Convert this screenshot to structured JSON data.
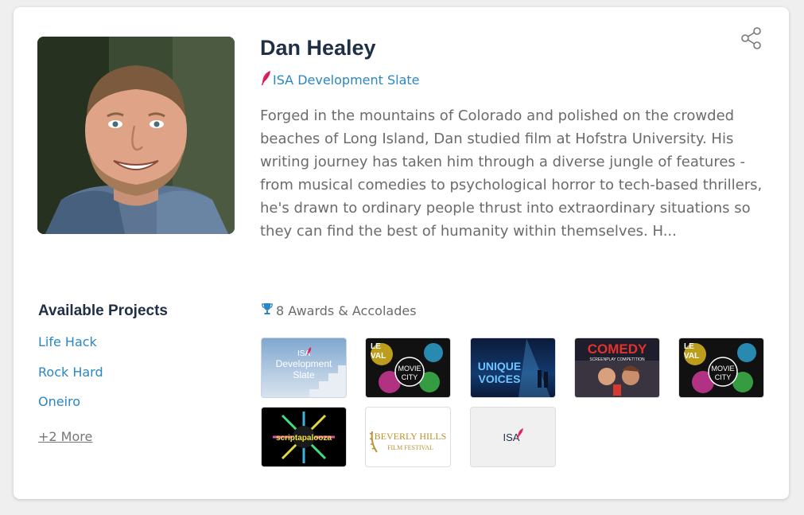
{
  "profile": {
    "name": "Dan Healey",
    "slate_label": "ISA Development Slate",
    "bio": "Forged in the mountains of Colorado and polished on the crowded beaches of Long Island, Dan studied film at Hofstra University. His writing journey has taken him through a diverse jungle of features - from musical comedies to psychological horror to tech-based thrillers, he's drawn to ordinary people thrust into extraordinary situations so they can find the best of humanity within themselves. H..."
  },
  "projects": {
    "title": "Available Projects",
    "items": [
      "Life Hack",
      "Rock Hard",
      "Oneiro"
    ],
    "more": "+2 More"
  },
  "awards": {
    "label": "8 Awards & Accolades",
    "badges": [
      {
        "lines": [
          "ISA",
          "Development",
          "Slate"
        ]
      },
      {
        "lines": [
          "LE",
          "VAL",
          "MOVIE",
          "CITY"
        ]
      },
      {
        "lines": [
          "UNIQUE",
          "VOICES"
        ]
      },
      {
        "lines": [
          "COMEDY",
          "SCREENPLAY COMPETITION"
        ]
      },
      {
        "lines": [
          "LE",
          "VAL",
          "MOVIE",
          "CITY"
        ]
      },
      {
        "lines": [
          "scriptapalooza"
        ]
      },
      {
        "lines": [
          "BEVERLY HILLS",
          "FILM FESTIVAL"
        ]
      },
      {
        "lines": [
          "ISA"
        ]
      }
    ]
  },
  "colors": {
    "accent": "#2a86c4",
    "title": "#1f2f45",
    "body_text": "#6b6b6b",
    "isa_pink": "#e0245e"
  },
  "icons": {
    "share": "share-icon",
    "slate": "feather-icon",
    "awards": "trophy-icon"
  }
}
